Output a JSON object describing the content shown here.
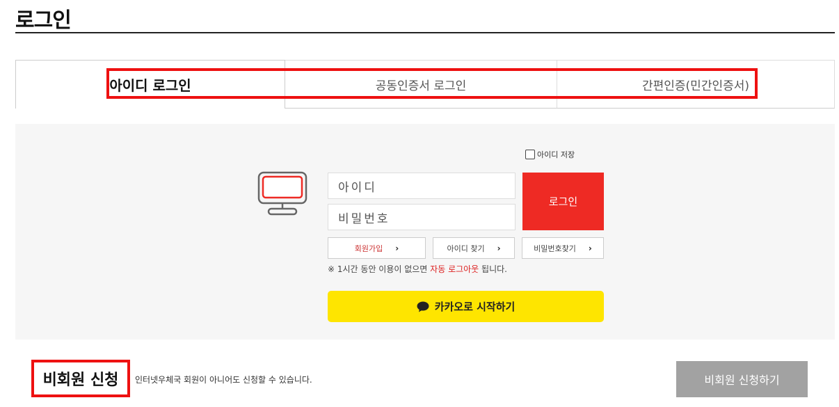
{
  "page": {
    "title": "로그인"
  },
  "tabs": [
    {
      "label": "아이디 로그인",
      "active": true
    },
    {
      "label": "공동인증서 로그인",
      "active": false
    },
    {
      "label": "간편인증(민간인증서)",
      "active": false
    }
  ],
  "login": {
    "save_id_label": "아이디 저장",
    "id_placeholder": "아이디",
    "pw_placeholder": "비밀번호",
    "login_button": "로그인",
    "join_label": "회원가입",
    "find_id_label": "아이디 찾기",
    "find_pw_label": "비밀번호찾기",
    "notice_prefix": "※ 1시간 동안 이용이 없으면 ",
    "notice_highlight": "자동 로그아웃",
    "notice_suffix": " 됩니다.",
    "kakao_label": "카카오로 시작하기",
    "accent_color": "#ee2a24",
    "kakao_color": "#fee500",
    "icons": {
      "monitor": "monitor-icon",
      "kakao": "speech-bubble-icon",
      "chevron": "chevron-right-icon"
    }
  },
  "non_member": {
    "title": "비회원 신청",
    "description": "인터넷우체국 회원이 아니어도 신청할 수 있습니다.",
    "button": "비회원 신청하기"
  },
  "highlight_color": "#ee1111"
}
